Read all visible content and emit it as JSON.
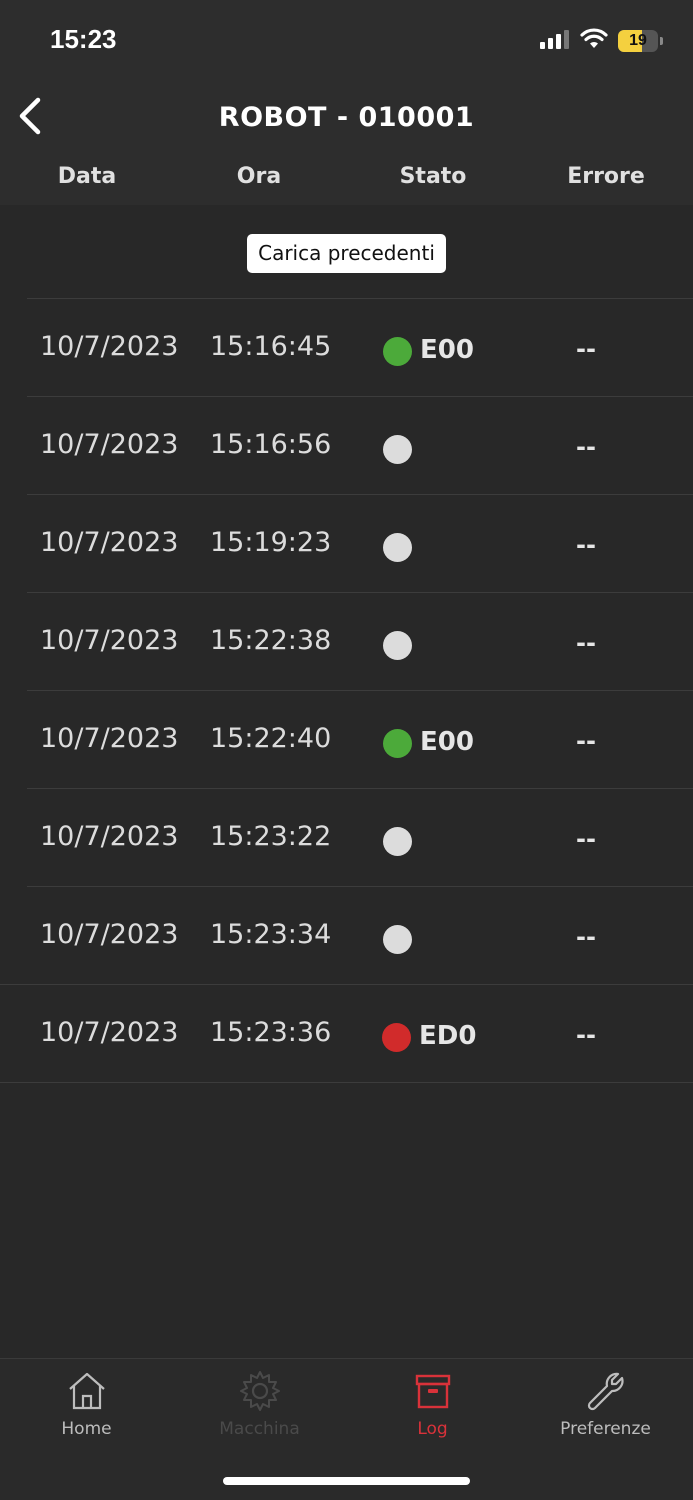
{
  "status_bar": {
    "time": "15:23",
    "battery_level": "19",
    "battery_fraction": 0.19,
    "battery_color": "#f4d03f"
  },
  "header": {
    "title": "ROBOT - 010001",
    "back_icon": "chevron-left-icon"
  },
  "columns": [
    "Data",
    "Ora",
    "Stato",
    "Errore"
  ],
  "load_previous_label": "Carica precedenti",
  "status_colors": {
    "green": "#4caa3a",
    "grey": "#dcdcdc",
    "red": "#d12b2b"
  },
  "log_rows": [
    {
      "date": "10/7/2023",
      "time": "15:16:45",
      "status": "green",
      "code": "E00",
      "error": "--"
    },
    {
      "date": "10/7/2023",
      "time": "15:16:56",
      "status": "grey",
      "code": "",
      "error": "--"
    },
    {
      "date": "10/7/2023",
      "time": "15:19:23",
      "status": "grey",
      "code": "",
      "error": "--"
    },
    {
      "date": "10/7/2023",
      "time": "15:22:38",
      "status": "grey",
      "code": "",
      "error": "--"
    },
    {
      "date": "10/7/2023",
      "time": "15:22:40",
      "status": "green",
      "code": "E00",
      "error": "--"
    },
    {
      "date": "10/7/2023",
      "time": "15:23:22",
      "status": "grey",
      "code": "",
      "error": "--"
    },
    {
      "date": "10/7/2023",
      "time": "15:23:34",
      "status": "grey",
      "code": "",
      "error": "--"
    },
    {
      "date": "10/7/2023",
      "time": "15:23:36",
      "status": "red",
      "code": "ED0",
      "error": "--"
    }
  ],
  "tabs": [
    {
      "label": "Home",
      "icon": "home-icon",
      "state": "normal",
      "color": "#bdbdbd"
    },
    {
      "label": "Macchina",
      "icon": "gear-icon",
      "state": "disabled",
      "color": "#4a4a4a"
    },
    {
      "label": "Log",
      "icon": "archive-box-icon",
      "state": "active",
      "color": "#d9323a"
    },
    {
      "label": "Preferenze",
      "icon": "wrench-icon",
      "state": "normal",
      "color": "#bdbdbd"
    }
  ]
}
